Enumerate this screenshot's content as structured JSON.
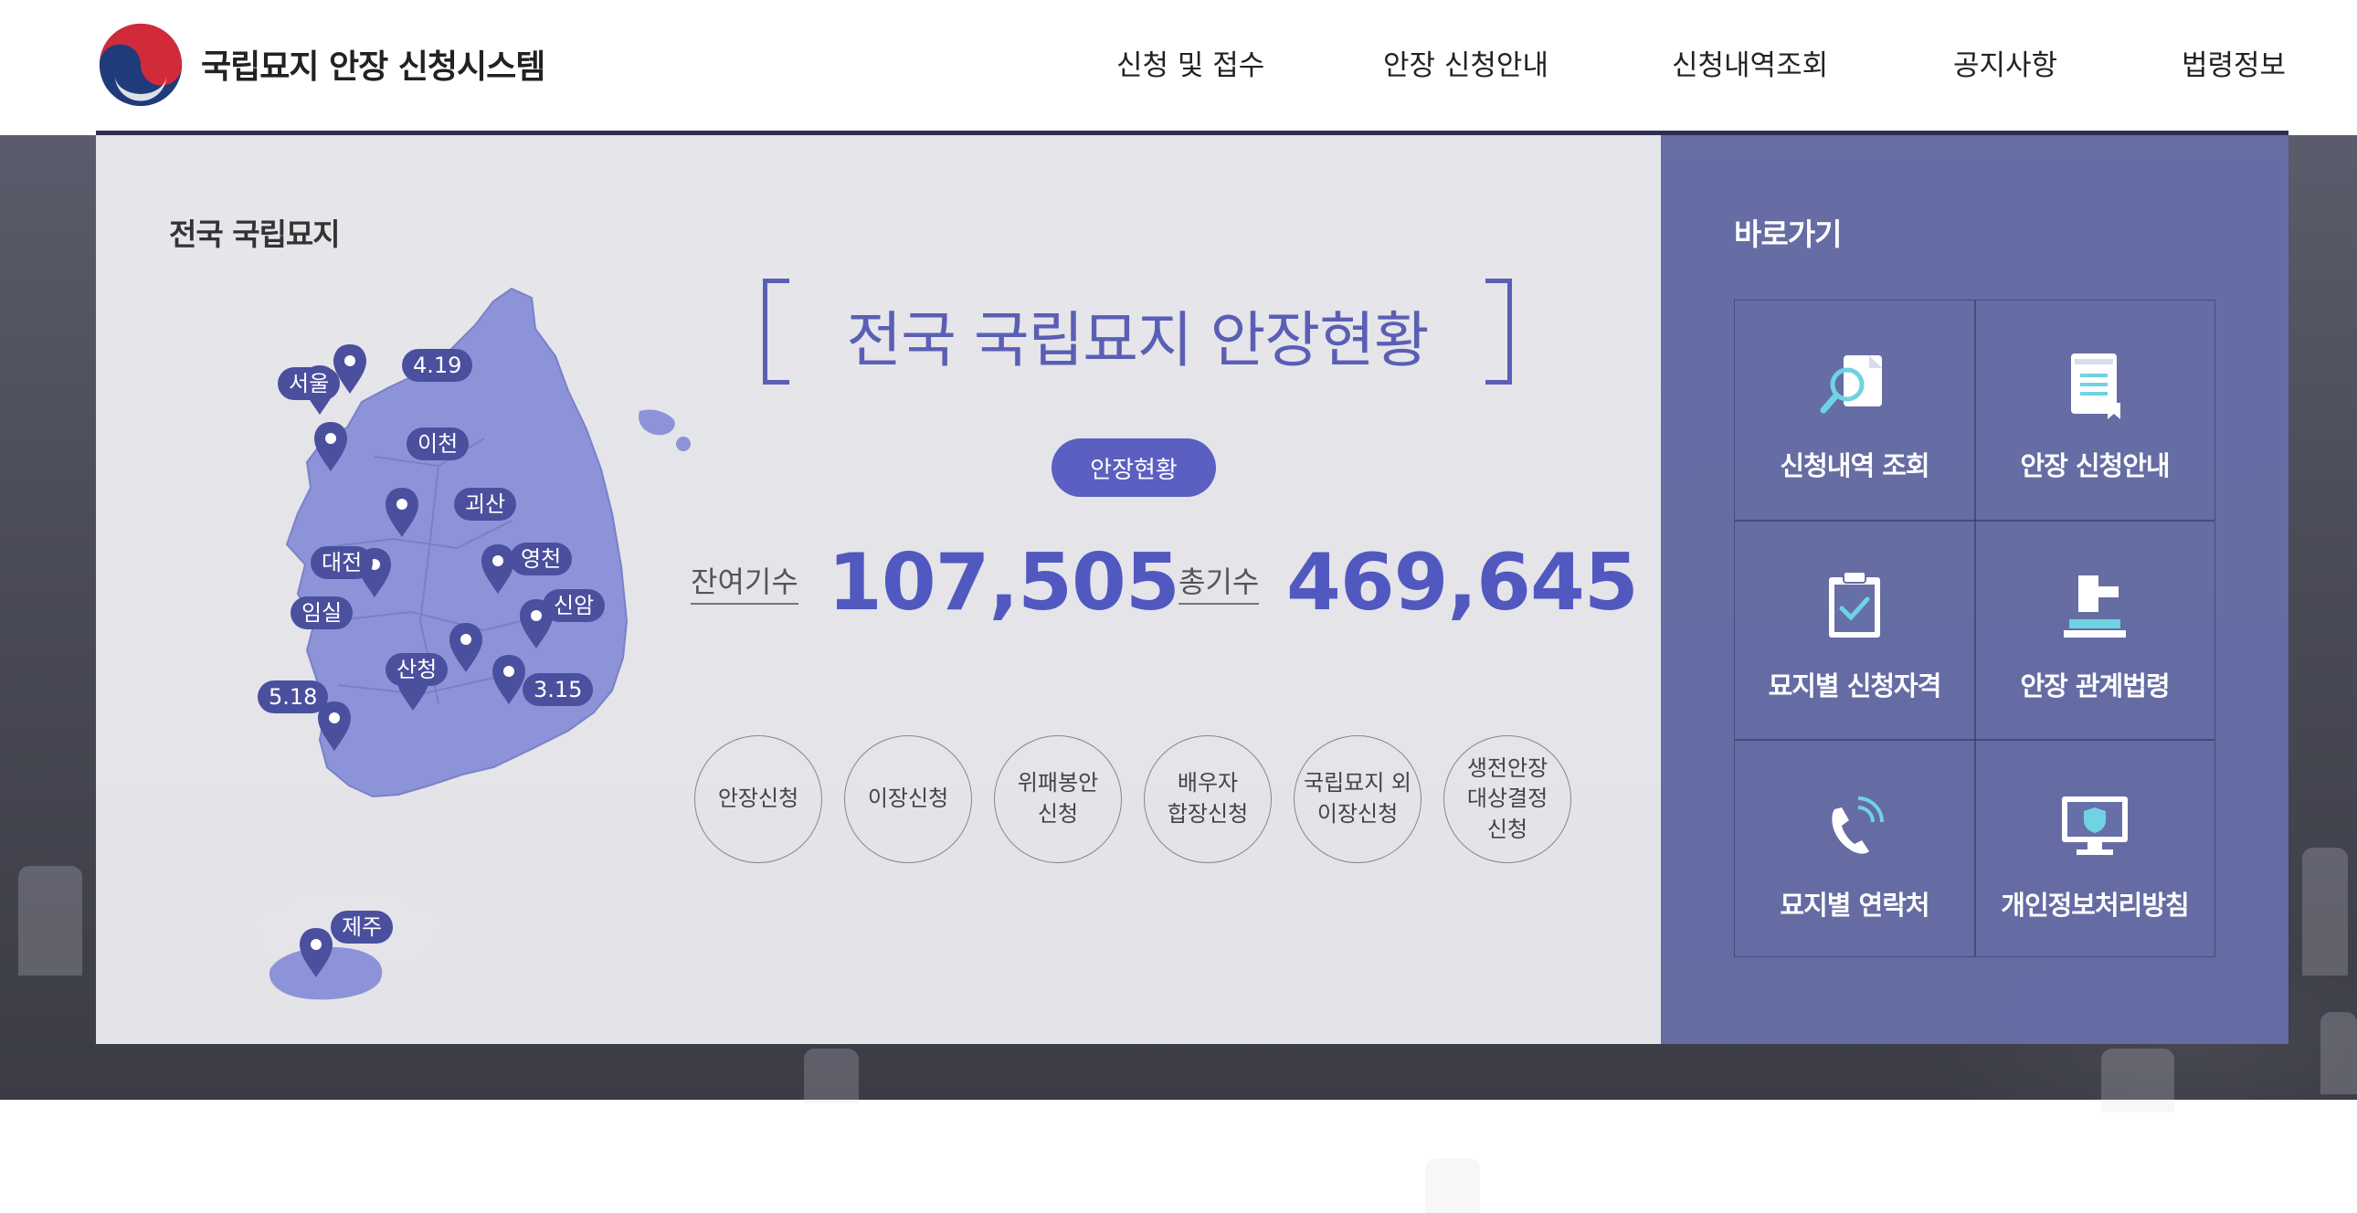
{
  "header": {
    "site_title": "국립묘지 안장 신청시스템",
    "nav": [
      "신청 및 접수",
      "안장 신청안내",
      "신청내역조회",
      "공지사항",
      "법령정보"
    ]
  },
  "map_section": {
    "title": "전국 국립묘지",
    "locations": [
      "4.19",
      "서울",
      "이천",
      "괴산",
      "영천",
      "대전",
      "신암",
      "임실",
      "산청",
      "3.15",
      "5.18",
      "제주"
    ]
  },
  "status": {
    "title": "전국 국립묘지 안장현황",
    "badge": "안장현황",
    "remaining_label": "잔여기수",
    "remaining_value": "107,505",
    "total_label": "총기수",
    "total_value": "469,645"
  },
  "apply_buttons": [
    "안장신청",
    "이장신청",
    "위패봉안\n신청",
    "배우자\n합장신청",
    "국립묘지 외\n이장신청",
    "생전안장\n대상결정\n신청"
  ],
  "quick": {
    "title": "바로가기",
    "items": [
      {
        "label": "신청내역 조회",
        "icon": "search-document-icon"
      },
      {
        "label": "안장 신청안내",
        "icon": "document-list-icon"
      },
      {
        "label": "묘지별 신청자격",
        "icon": "clipboard-check-icon"
      },
      {
        "label": "안장 관계법령",
        "icon": "gavel-icon"
      },
      {
        "label": "묘지별 연락처",
        "icon": "phone-icon"
      },
      {
        "label": "개인정보처리방침",
        "icon": "monitor-shield-icon"
      }
    ]
  },
  "colors": {
    "accent": "#5a5fc1",
    "map_fill": "#8d93d8",
    "pin": "#4a4f9e",
    "quick_panel": "#676fa8",
    "icon_accent": "#6fd3e2"
  }
}
